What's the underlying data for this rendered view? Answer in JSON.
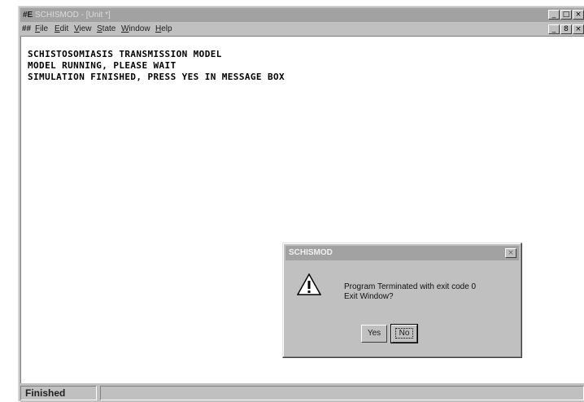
{
  "window": {
    "app_icon": "#E",
    "title": "SCHISMOD - [Unit *]",
    "controls": [
      "_",
      "□",
      "×"
    ]
  },
  "menubar": {
    "icon": "##",
    "items": [
      "File",
      "Edit",
      "View",
      "State",
      "Window",
      "Help"
    ],
    "controls": [
      "_",
      "8",
      "×"
    ]
  },
  "console": {
    "lines": [
      "SCHISTOSOMIASIS TRANSMISSION MODEL",
      "MODEL RUNNING, PLEASE WAIT",
      "SIMULATION FINISHED, PRESS YES IN MESSAGE BOX"
    ]
  },
  "statusbar": {
    "text": "Finished",
    "second": ""
  },
  "dialog": {
    "title": "SCHISMOD",
    "close": "×",
    "icon": "warning-icon",
    "message_line1": "Program Terminated with exit code 0",
    "message_line2": "Exit Window?",
    "yes_label": "Yes",
    "no_label": "No"
  },
  "colors": {
    "face": "#c0c0c0",
    "title_inactive": "#a2a2a2",
    "client": "#ffffff"
  }
}
